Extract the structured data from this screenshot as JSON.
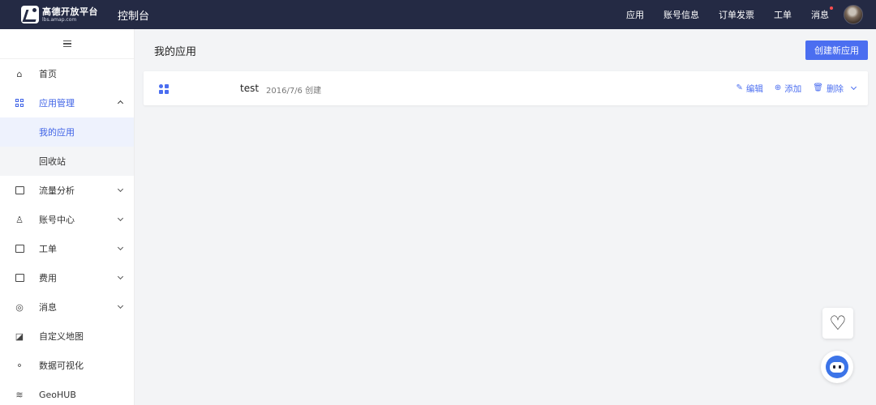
{
  "topbar": {
    "logo_name": "高德开放平台",
    "logo_url": "lbs.amap.com",
    "console_title": "控制台",
    "nav": [
      "应用",
      "账号信息",
      "订单发票",
      "工单",
      "消息"
    ]
  },
  "sidebar": {
    "items": [
      {
        "label": "首页",
        "icon": "home-icon"
      },
      {
        "label": "应用管理",
        "icon": "grid-icon",
        "expanded": true
      },
      {
        "label": "我的应用",
        "sub": true,
        "current": true
      },
      {
        "label": "回收站",
        "sub": true
      },
      {
        "label": "流量分析",
        "icon": "chart-icon"
      },
      {
        "label": "账号中心",
        "icon": "user-icon"
      },
      {
        "label": "工单",
        "icon": "ticket-icon"
      },
      {
        "label": "费用",
        "icon": "fee-icon"
      },
      {
        "label": "消息",
        "icon": "message-icon"
      },
      {
        "label": "自定义地图",
        "icon": "map-icon"
      },
      {
        "label": "数据可视化",
        "icon": "visualization-icon"
      },
      {
        "label": "GeoHUB",
        "icon": "layers-icon"
      }
    ]
  },
  "main": {
    "title": "我的应用",
    "create_button": "创建新应用",
    "app": {
      "name": "test",
      "created": "2016/7/6 创建",
      "actions": {
        "edit": "编辑",
        "add": "添加",
        "delete": "删除"
      }
    }
  },
  "colors": {
    "topbar": "#242a44",
    "accent": "#4b6ef0"
  }
}
